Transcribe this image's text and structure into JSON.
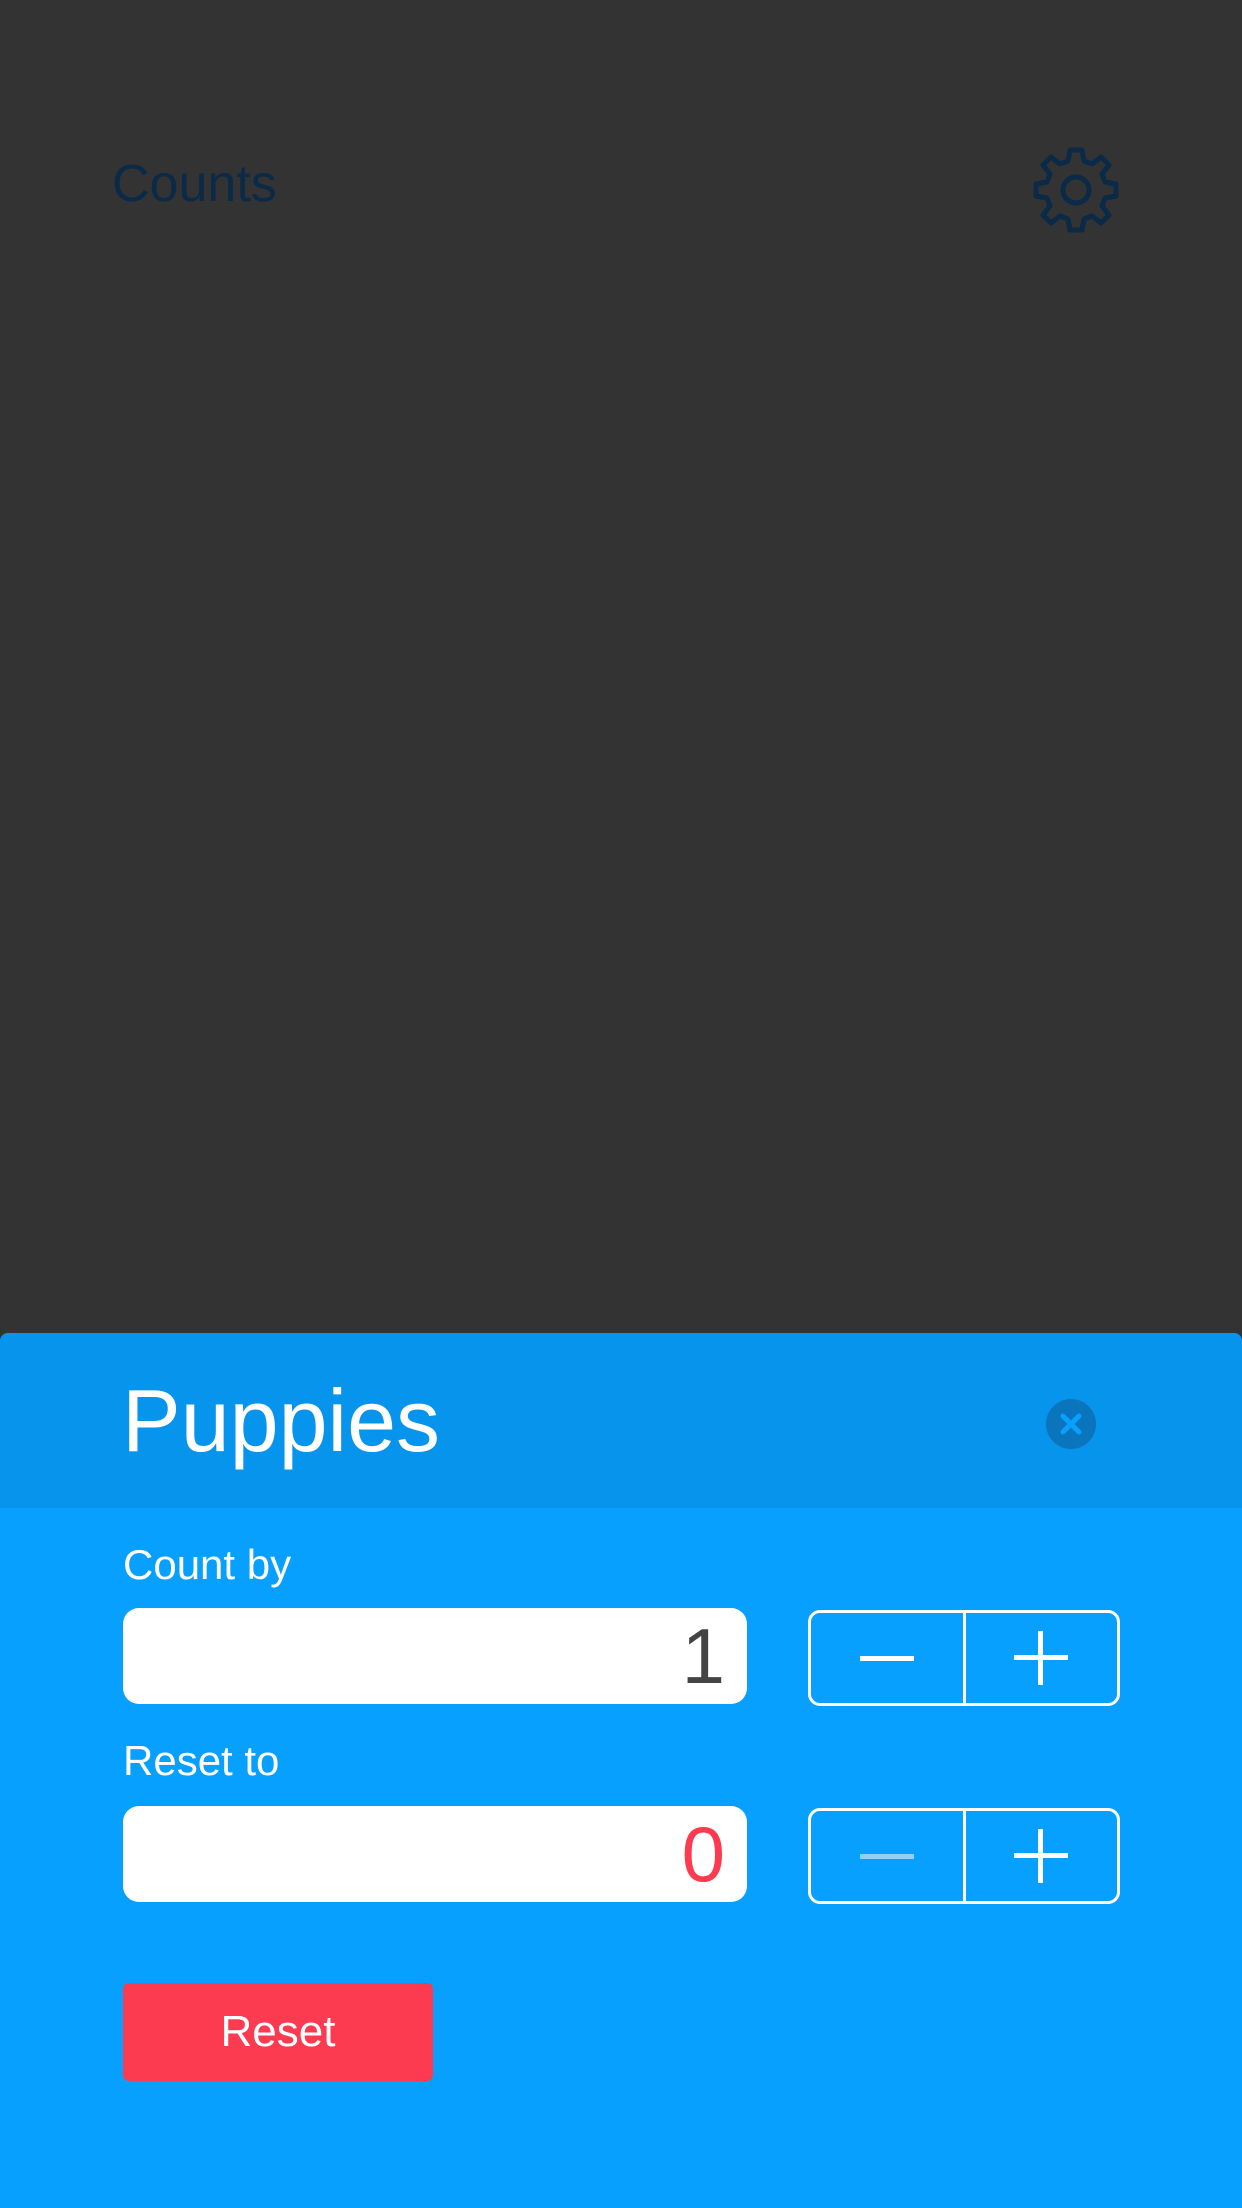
{
  "header": {
    "title": "Counts",
    "settings_icon": "gear-icon",
    "title_color": "#0a2a47"
  },
  "sheet": {
    "title": "Puppies",
    "close_icon": "close-icon",
    "count_by": {
      "label": "Count by",
      "value": "1",
      "value_color": "#444444",
      "minus_enabled": true,
      "plus_enabled": true
    },
    "reset_to": {
      "label": "Reset to",
      "value": "0",
      "value_color": "#fc3a50",
      "minus_enabled": false,
      "plus_enabled": true
    },
    "reset_button": "Reset"
  },
  "colors": {
    "background": "#333333",
    "sheet": "#08a0fe",
    "sheet_header": "#0794ec",
    "reset_button": "#fc3a50"
  }
}
